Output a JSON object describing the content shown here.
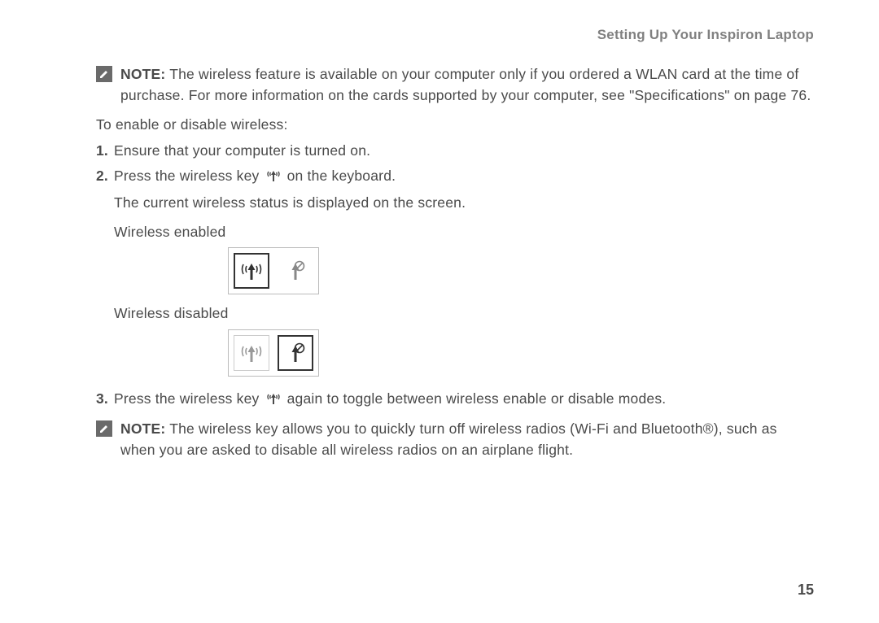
{
  "header": "Setting Up Your Inspiron Laptop",
  "note1": {
    "label": "NOTE:",
    "text": " The wireless feature is available on your computer only if you ordered a WLAN card at the time of purchase. For more information on the cards supported by your computer, see \"Specifications\" on page 76."
  },
  "instruction": "To enable or disable wireless:",
  "steps": {
    "s1": {
      "num": "1.",
      "text": "Ensure that your computer is turned on."
    },
    "s2": {
      "num": "2.",
      "text_a": "Press the wireless key ",
      "text_b": " on the keyboard.",
      "sub": "The current wireless status is displayed on the screen.",
      "enabled_label": "Wireless enabled",
      "disabled_label": "Wireless disabled"
    },
    "s3": {
      "num": "3.",
      "text_a": "Press the wireless key ",
      "text_b": " again to toggle between wireless enable or disable modes."
    }
  },
  "note2": {
    "label": "NOTE:",
    "text": " The wireless key allows you to quickly turn off wireless radios (Wi-Fi and Bluetooth®), such as when you are asked to disable all wireless radios on an airplane flight."
  },
  "page_number": "15"
}
